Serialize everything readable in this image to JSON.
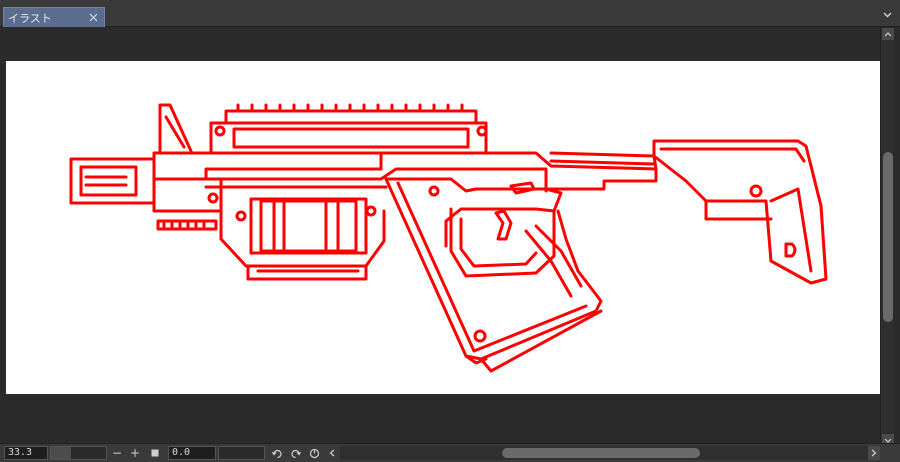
{
  "tab": {
    "label": "イラスト"
  },
  "status": {
    "zoom_value": "33.3",
    "angle_value": "0.0",
    "zoom_out_label": "−",
    "zoom_in_label": "+"
  },
  "colors": {
    "accent_tab": "#5a6d8f",
    "line_art": "#ff0000",
    "paper": "#ffffff",
    "workspace": "#2b2b2b"
  },
  "icons": {
    "tab_close": "close-icon",
    "tab_menu": "chevron-down-icon",
    "fit": "square-icon",
    "rotate_left": "rotate-left-icon",
    "rotate_right": "rotate-right-icon",
    "reset_rotation": "reset-rotation-icon",
    "scroll_left": "chevron-left-icon",
    "scroll_right": "chevron-right-icon",
    "scroll_up": "chevron-up-icon",
    "scroll_down": "chevron-down-icon"
  }
}
